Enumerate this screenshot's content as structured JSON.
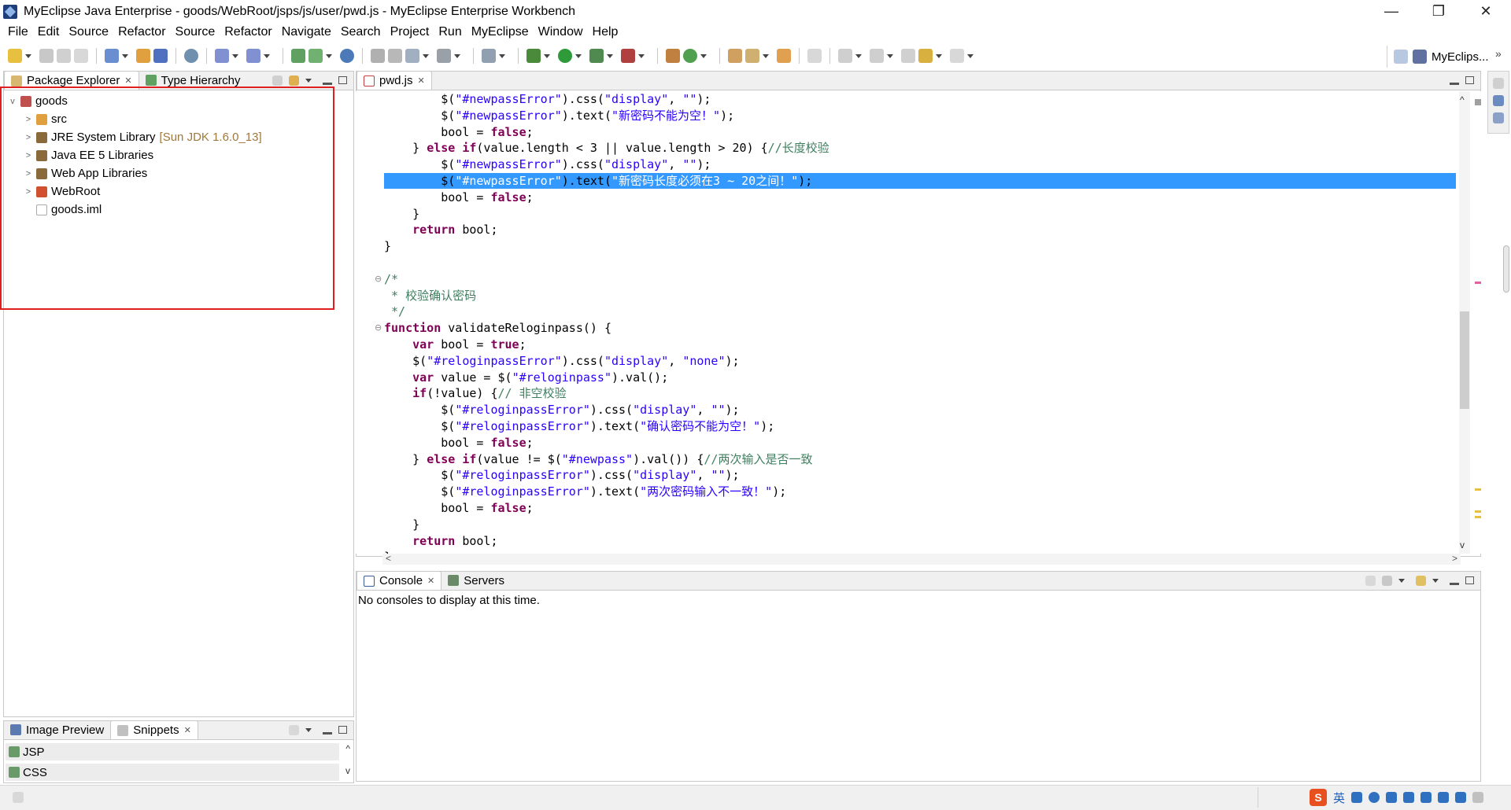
{
  "window": {
    "title": "MyEclipse Java Enterprise - goods/WebRoot/jsps/js/user/pwd.js - MyEclipse Enterprise Workbench",
    "minimize": "—",
    "restore": "❐",
    "close": "✕"
  },
  "menu": [
    "File",
    "Edit",
    "Source",
    "Refactor",
    "Source",
    "Refactor",
    "Navigate",
    "Search",
    "Project",
    "Run",
    "MyEclipse",
    "Window",
    "Help"
  ],
  "perspective": {
    "label": "MyEclips..."
  },
  "left_panel": {
    "tabs": [
      {
        "label": "Package Explorer",
        "close": "✕"
      },
      {
        "label": "Type Hierarchy"
      }
    ],
    "tree": {
      "root": "goods",
      "children": [
        {
          "label": "src",
          "decoration": ""
        },
        {
          "label": "JRE System Library",
          "decoration": "[Sun JDK 1.6.0_13]"
        },
        {
          "label": "Java EE 5 Libraries",
          "decoration": ""
        },
        {
          "label": "Web App Libraries",
          "decoration": ""
        },
        {
          "label": "WebRoot",
          "decoration": ""
        },
        {
          "label": "goods.iml",
          "decoration": ""
        }
      ]
    }
  },
  "bottom_left_panel": {
    "tabs": [
      {
        "label": "Image Preview"
      },
      {
        "label": "Snippets",
        "close": "✕"
      }
    ],
    "items": [
      "JSP",
      "CSS"
    ]
  },
  "editor": {
    "tab": {
      "label": "pwd.js",
      "close": "✕"
    },
    "lines": [
      {
        "t": "        $(\"#newpassError\").css(\"display\", \"\");",
        "hl": false
      },
      {
        "t": "        $(\"#newpassError\").text(\"新密码不能为空！\");",
        "hl": false
      },
      {
        "t": "        bool = false;",
        "hl": false
      },
      {
        "t": "    } else if(value.length < 3 || value.length > 20) {//长度校验",
        "hl": false
      },
      {
        "t": "        $(\"#newpassError\").css(\"display\", \"\");",
        "hl": false
      },
      {
        "t": "        $(\"#newpassError\").text(\"新密码长度必须在3 ~ 20之间！\");",
        "hl": true
      },
      {
        "t": "        bool = false;",
        "hl": false
      },
      {
        "t": "    }",
        "hl": false
      },
      {
        "t": "    return bool;",
        "hl": false
      },
      {
        "t": "}",
        "hl": false
      },
      {
        "t": "",
        "hl": false
      },
      {
        "t": "/*",
        "hl": false
      },
      {
        "t": " * 校验确认密码",
        "hl": false
      },
      {
        "t": " */",
        "hl": false
      },
      {
        "t": "function validateReloginpass() {",
        "hl": false
      },
      {
        "t": "    var bool = true;",
        "hl": false
      },
      {
        "t": "    $(\"#reloginpassError\").css(\"display\", \"none\");",
        "hl": false
      },
      {
        "t": "    var value = $(\"#reloginpass\").val();",
        "hl": false
      },
      {
        "t": "    if(!value) {// 非空校验",
        "hl": false
      },
      {
        "t": "        $(\"#reloginpassError\").css(\"display\", \"\");",
        "hl": false
      },
      {
        "t": "        $(\"#reloginpassError\").text(\"确认密码不能为空！\");",
        "hl": false
      },
      {
        "t": "        bool = false;",
        "hl": false
      },
      {
        "t": "    } else if(value != $(\"#newpass\").val()) {//两次输入是否一致",
        "hl": false
      },
      {
        "t": "        $(\"#reloginpassError\").css(\"display\", \"\");",
        "hl": false
      },
      {
        "t": "        $(\"#reloginpassError\").text(\"两次密码输入不一致！\");",
        "hl": false
      },
      {
        "t": "        bool = false;",
        "hl": false
      },
      {
        "t": "    }",
        "hl": false
      },
      {
        "t": "    return bool;",
        "hl": false
      },
      {
        "t": "}",
        "hl": false
      }
    ]
  },
  "console_panel": {
    "tabs": [
      {
        "label": "Console",
        "close": "✕"
      },
      {
        "label": "Servers"
      }
    ],
    "message": "No consoles to display at this time."
  },
  "tray": {
    "ime": "英"
  },
  "colors": {
    "highlight": "#3399ff",
    "keyword": "#7f0055",
    "string": "#2a00ff",
    "comment": "#3f7f5f",
    "annotation_box": "#e02020"
  }
}
